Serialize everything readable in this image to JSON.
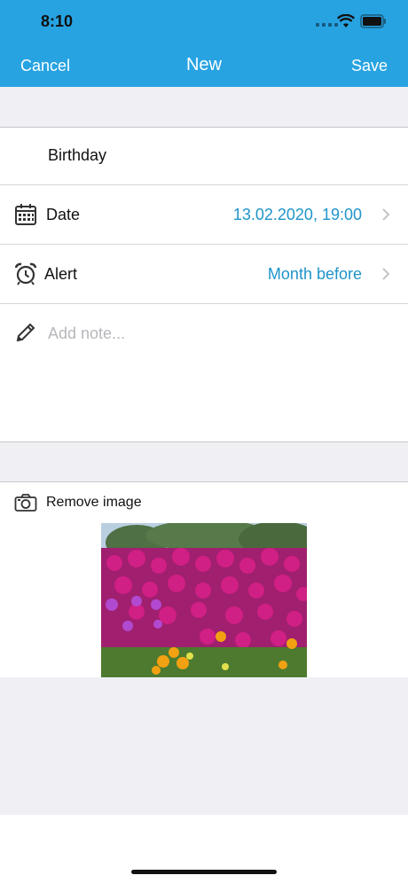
{
  "status_bar": {
    "time": "8:10"
  },
  "nav": {
    "cancel": "Cancel",
    "title": "New",
    "save": "Save"
  },
  "form": {
    "title_value": "Birthday",
    "date": {
      "label": "Date",
      "value": "13.02.2020, 19:00",
      "icon": "calendar-icon"
    },
    "alert": {
      "label": "Alert",
      "value": "Month before",
      "icon": "alarm-clock-icon"
    },
    "note": {
      "placeholder": "Add note...",
      "icon": "pencil-icon"
    }
  },
  "image_section": {
    "remove_label": "Remove image",
    "icon": "camera-icon"
  },
  "colors": {
    "header": "#27a3e2",
    "accent": "#1f94c9",
    "background": "#efeff4"
  }
}
